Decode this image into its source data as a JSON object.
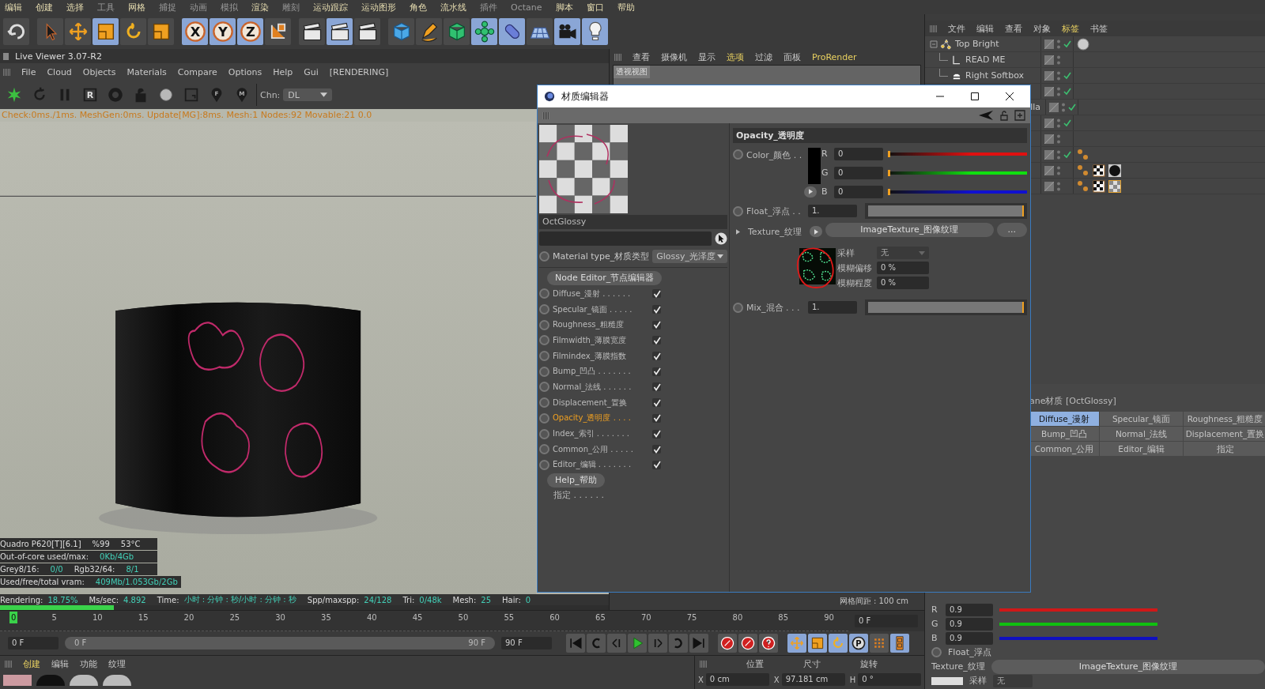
{
  "menubar": [
    {
      "label": "编辑",
      "highlighted": true
    },
    {
      "label": "创建",
      "highlighted": true
    },
    {
      "label": "选择",
      "highlighted": true
    },
    {
      "label": "工具",
      "highlighted": false
    },
    {
      "label": "网格",
      "highlighted": true
    },
    {
      "label": "捕捉",
      "highlighted": false
    },
    {
      "label": "动画",
      "highlighted": false
    },
    {
      "label": "模拟",
      "highlighted": false
    },
    {
      "label": "渲染",
      "highlighted": true
    },
    {
      "label": "雕刻",
      "highlighted": false
    },
    {
      "label": "运动跟踪",
      "highlighted": true
    },
    {
      "label": "运动图形",
      "highlighted": true
    },
    {
      "label": "角色",
      "highlighted": true
    },
    {
      "label": "流水线",
      "highlighted": true
    },
    {
      "label": "插件",
      "highlighted": false
    },
    {
      "label": "Octane",
      "highlighted": false
    },
    {
      "label": "脚本",
      "highlighted": true
    },
    {
      "label": "窗口",
      "highlighted": true
    },
    {
      "label": "帮助",
      "highlighted": true
    }
  ],
  "toolbar": [
    {
      "kind": "undo",
      "selected": false
    },
    {
      "kind": "cursor",
      "selected": false
    },
    {
      "kind": "move",
      "selected": false
    },
    {
      "kind": "scale",
      "selected": true
    },
    {
      "kind": "rotate",
      "selected": false
    },
    {
      "kind": "scale",
      "selected": false
    },
    {
      "kind": "axis",
      "label": "X",
      "selected": true
    },
    {
      "kind": "axis",
      "label": "Y",
      "selected": true
    },
    {
      "kind": "axis",
      "label": "Z",
      "selected": true
    },
    {
      "kind": "coordinates",
      "selected": false
    },
    {
      "kind": "clapperboard",
      "selected": false
    },
    {
      "kind": "clapperboard",
      "selected": true
    },
    {
      "kind": "clapperboard",
      "selected": false
    },
    {
      "kind": "cube",
      "selected": false
    },
    {
      "kind": "pen",
      "selected": false
    },
    {
      "kind": "generator",
      "selected": false
    },
    {
      "kind": "flower",
      "selected": true
    },
    {
      "kind": "capsule",
      "selected": true
    },
    {
      "kind": "floor",
      "selected": false
    },
    {
      "kind": "camera",
      "selected": true
    },
    {
      "kind": "light-bulb",
      "selected": true
    }
  ],
  "live_viewer": {
    "title": "Live Viewer 3.07-R2",
    "menu": [
      "File",
      "Cloud",
      "Objects",
      "Materials",
      "Compare",
      "Options",
      "Help",
      "Gui",
      "[RENDERING]"
    ],
    "tools": [
      {
        "kind": "octane-star"
      },
      {
        "kind": "refresh"
      },
      {
        "kind": "pause"
      },
      {
        "kind": "letter-square",
        "label": "R"
      },
      {
        "kind": "gear"
      },
      {
        "kind": "padlock"
      },
      {
        "kind": "sphere"
      },
      {
        "kind": "frame"
      },
      {
        "kind": "pin",
        "label": "F"
      },
      {
        "kind": "pin",
        "label": "M"
      }
    ],
    "channel_label": "Chn:",
    "channel_value": "DL",
    "status": "Check:0ms./1ms. MeshGen:0ms. Update[MG]:8ms. Mesh:1 Nodes:92 Movable:21  0.0",
    "stats": [
      [
        {
          "kind": "label",
          "text": "Quadro P620[T][6.1]"
        },
        {
          "kind": "label",
          "text": "%99"
        },
        {
          "kind": "label",
          "text": "53°C"
        }
      ],
      [
        {
          "kind": "label",
          "text": "Out-of-core used/max:"
        },
        {
          "kind": "value",
          "text": "0Kb/4Gb"
        }
      ],
      [
        {
          "kind": "label",
          "text": "Grey8/16:"
        },
        {
          "kind": "value",
          "text": "0/0"
        },
        {
          "kind": "label",
          "text": "Rgb32/64:"
        },
        {
          "kind": "value",
          "text": "8/1"
        }
      ],
      [
        {
          "kind": "label",
          "text": "Used/free/total vram:"
        },
        {
          "kind": "value",
          "text": "409Mb/1.053Gb/2Gb"
        }
      ]
    ],
    "render_line": [
      {
        "kind": "label",
        "text": "Rendering:"
      },
      {
        "kind": "value",
        "text": "18.75%"
      },
      {
        "kind": "label",
        "text": "Ms/sec:"
      },
      {
        "kind": "value",
        "text": "4.892"
      },
      {
        "kind": "label",
        "text": "Time:"
      },
      {
        "kind": "value",
        "text": "小时 : 分钟 : 秒/小时 : 分钟 : 秒"
      },
      {
        "kind": "label",
        "text": "Spp/maxspp:"
      },
      {
        "kind": "value",
        "text": "24/128"
      },
      {
        "kind": "label",
        "text": "Tri:"
      },
      {
        "kind": "value",
        "text": "0/48k"
      },
      {
        "kind": "label",
        "text": "Mesh:"
      },
      {
        "kind": "value",
        "text": "25"
      },
      {
        "kind": "label",
        "text": "Hair:"
      },
      {
        "kind": "value",
        "text": "0"
      }
    ],
    "progress": {
      "level": 0.1875
    }
  },
  "viewport": {
    "menu": [
      {
        "label": "查看",
        "selected": false
      },
      {
        "label": "摄像机",
        "selected": false
      },
      {
        "label": "显示",
        "selected": false
      },
      {
        "label": "选项",
        "selected": true
      },
      {
        "label": "过滤",
        "selected": false
      },
      {
        "label": "面板",
        "selected": false
      },
      {
        "label": "ProRender",
        "selected": true
      }
    ],
    "view_label": "透视视图",
    "grid_status": "网格间距 : 100 cm"
  },
  "timeline": {
    "ticks": [
      {
        "label": "0",
        "current": true
      },
      {
        "label": "5",
        "current": false
      },
      {
        "label": "10",
        "current": false
      },
      {
        "label": "15",
        "current": false
      },
      {
        "label": "20",
        "current": false
      },
      {
        "label": "25",
        "current": false
      },
      {
        "label": "30",
        "current": false
      },
      {
        "label": "35",
        "current": false
      },
      {
        "label": "40",
        "current": false
      },
      {
        "label": "45",
        "current": false
      },
      {
        "label": "50",
        "current": false
      },
      {
        "label": "55",
        "current": false
      },
      {
        "label": "60",
        "current": false
      },
      {
        "label": "65",
        "current": false
      },
      {
        "label": "70",
        "current": false
      },
      {
        "label": "75",
        "current": false
      },
      {
        "label": "80",
        "current": false
      },
      {
        "label": "85",
        "current": false
      },
      {
        "label": "90",
        "current": false
      }
    ],
    "frame_field": "0 F",
    "start_field": "0 F",
    "range_start": "0 F",
    "range_end": "90 F",
    "end_field": "90 F",
    "transport": [
      {
        "kind": "skip-start",
        "selected": false
      },
      {
        "kind": "loop-back",
        "selected": false
      },
      {
        "kind": "step-back",
        "selected": false
      },
      {
        "kind": "play",
        "selected": false
      },
      {
        "kind": "step-forward",
        "selected": false
      },
      {
        "kind": "loop-forward",
        "selected": false
      },
      {
        "kind": "skip-end",
        "selected": false
      },
      {
        "kind": "record-key",
        "selected": false
      },
      {
        "kind": "record-key",
        "selected": false
      },
      {
        "kind": "help-key",
        "selected": false
      },
      {
        "kind": "move",
        "selected": true
      },
      {
        "kind": "scale",
        "selected": true
      },
      {
        "kind": "rotate",
        "selected": true
      },
      {
        "kind": "letter-circle",
        "label": "P",
        "selected": true
      },
      {
        "kind": "dot-grid",
        "selected": false
      },
      {
        "kind": "film-strip",
        "selected": true
      }
    ]
  },
  "material_manager": {
    "menu": [
      {
        "label": "创建",
        "selected": true
      },
      {
        "label": "编辑",
        "selected": false
      },
      {
        "label": "功能",
        "selected": false
      },
      {
        "label": "纹理",
        "selected": false
      }
    ]
  },
  "coordinates": {
    "headers": [
      "位置",
      "尺寸",
      "旋转"
    ],
    "fields": [
      {
        "axis": "X",
        "value": "0 cm"
      },
      {
        "axis": "X",
        "value": "97.181 cm"
      },
      {
        "axis": "H",
        "value": "0 °"
      }
    ]
  },
  "object_manager": {
    "menu": [
      {
        "label": "文件",
        "selected": false
      },
      {
        "label": "编辑",
        "selected": false
      },
      {
        "label": "查看",
        "selected": false
      },
      {
        "label": "对象",
        "selected": false
      },
      {
        "label": "标签",
        "selected": true
      },
      {
        "label": "书签",
        "selected": false
      }
    ],
    "rows": [
      {
        "kind": "root",
        "name": "Top Bright",
        "checked": true,
        "tags": [
          {
            "kind": "sphere"
          }
        ]
      },
      {
        "kind": "child",
        "name": "READ ME",
        "checked": false,
        "tags": []
      },
      {
        "kind": "child",
        "name": "Right Softbox",
        "checked": true,
        "tags": []
      },
      {
        "kind": "hidden",
        "checked": true,
        "tags": []
      },
      {
        "kind": "partial",
        "name": "lla",
        "checked": true,
        "tags": []
      },
      {
        "kind": "hidden",
        "checked": true,
        "tags": []
      },
      {
        "kind": "hidden",
        "checked": false,
        "tags": []
      },
      {
        "kind": "hidden",
        "checked": true,
        "tags": [
          {
            "kind": "octane"
          }
        ]
      },
      {
        "kind": "hidden",
        "checked": false,
        "tags": [
          {
            "kind": "octane"
          },
          {
            "kind": "checker"
          },
          {
            "kind": "dark-ball"
          }
        ]
      },
      {
        "kind": "hidden",
        "checked": false,
        "tags": [
          {
            "kind": "octane"
          },
          {
            "kind": "checker"
          },
          {
            "kind": "checker-ball"
          }
        ]
      }
    ]
  },
  "attributes": {
    "title": "ane材质 [OctGlossy]",
    "tabs": [
      {
        "label": "Diffuse_漫射",
        "selected": true
      },
      {
        "label": "Specular_镜面",
        "selected": false
      },
      {
        "label": "Roughness_粗糙度",
        "selected": false
      },
      {
        "label": "Bump_凹凸",
        "selected": false
      },
      {
        "label": "Normal_法线",
        "selected": false
      },
      {
        "label": "Displacement_置换",
        "selected": false
      },
      {
        "label": "Common_公用",
        "selected": false
      },
      {
        "label": "Editor_编辑",
        "selected": false
      },
      {
        "label": "指定",
        "selected": false
      }
    ],
    "channels": [
      {
        "name": "R",
        "value": "0.9",
        "color": "#d01818"
      },
      {
        "name": "G",
        "value": "0.9",
        "color": "#10c010"
      },
      {
        "name": "B",
        "value": "0.9",
        "color": "#1010c0"
      }
    ],
    "float_label": "Float_浮点",
    "texture_label": "Texture_纹理",
    "texture_button": "ImageTexture_图像纹理",
    "sample_label": "采样",
    "sample_value": "无"
  },
  "material_editor": {
    "title": "材质编辑器",
    "name": "OctGlossy",
    "type_label": "Material type_材质类型",
    "type_value": "Glossy_光泽度",
    "node_button": "Node Editor_节点编辑器",
    "channels": [
      {
        "label": "Diffuse_漫射 . . . . . .",
        "checked": true,
        "selected": false
      },
      {
        "label": "Specular_镜面 . . . . .",
        "checked": true,
        "selected": false
      },
      {
        "label": "Roughness_粗糙度",
        "checked": true,
        "selected": false
      },
      {
        "label": "Filmwidth_薄膜宽度",
        "checked": true,
        "selected": false
      },
      {
        "label": "Filmindex_薄膜指数",
        "checked": true,
        "selected": false
      },
      {
        "label": "Bump_凹凸 . . . . . . .",
        "checked": true,
        "selected": false
      },
      {
        "label": "Normal_法线 . . . . . .",
        "checked": true,
        "selected": false
      },
      {
        "label": "Displacement_置换",
        "checked": true,
        "selected": false
      },
      {
        "label": "Opacity_透明度 . . . .",
        "checked": true,
        "selected": true
      },
      {
        "label": "Index_索引 . . . . . . .",
        "checked": true,
        "selected": false
      },
      {
        "label": "Common_公用 . . . . .",
        "checked": true,
        "selected": false
      },
      {
        "label": "Editor_编辑 . . . . . . .",
        "checked": true,
        "selected": false
      }
    ],
    "help_button": "Help_帮助",
    "assign_label": "指定 . . . . . .",
    "section": "Opacity_透明度",
    "color": {
      "label": "Color_颜色 . .",
      "color": "#000000",
      "channels": [
        {
          "name": "R",
          "value": "0",
          "level": 0,
          "color": "#e01010"
        },
        {
          "name": "G",
          "value": "0",
          "level": 0,
          "color": "#10e010"
        },
        {
          "name": "B",
          "value": "0",
          "level": 0,
          "color": "#1010d0"
        }
      ]
    },
    "float": {
      "label": "Float_浮点 . .",
      "value": "1.",
      "level": 1
    },
    "texture": {
      "label": "Texture_纹理",
      "button": "ImageTexture_图像纹理",
      "more": "...",
      "params": [
        {
          "kind": "select",
          "label": "采样",
          "value": "无",
          "disabled": true
        },
        {
          "kind": "number",
          "label": "模糊偏移",
          "value": "0 %",
          "disabled": false
        },
        {
          "kind": "number",
          "label": "模糊程度",
          "value": "0 %",
          "disabled": false
        }
      ]
    },
    "mix": {
      "label": "Mix_混合 . . .",
      "value": "1.",
      "level": 1
    }
  }
}
